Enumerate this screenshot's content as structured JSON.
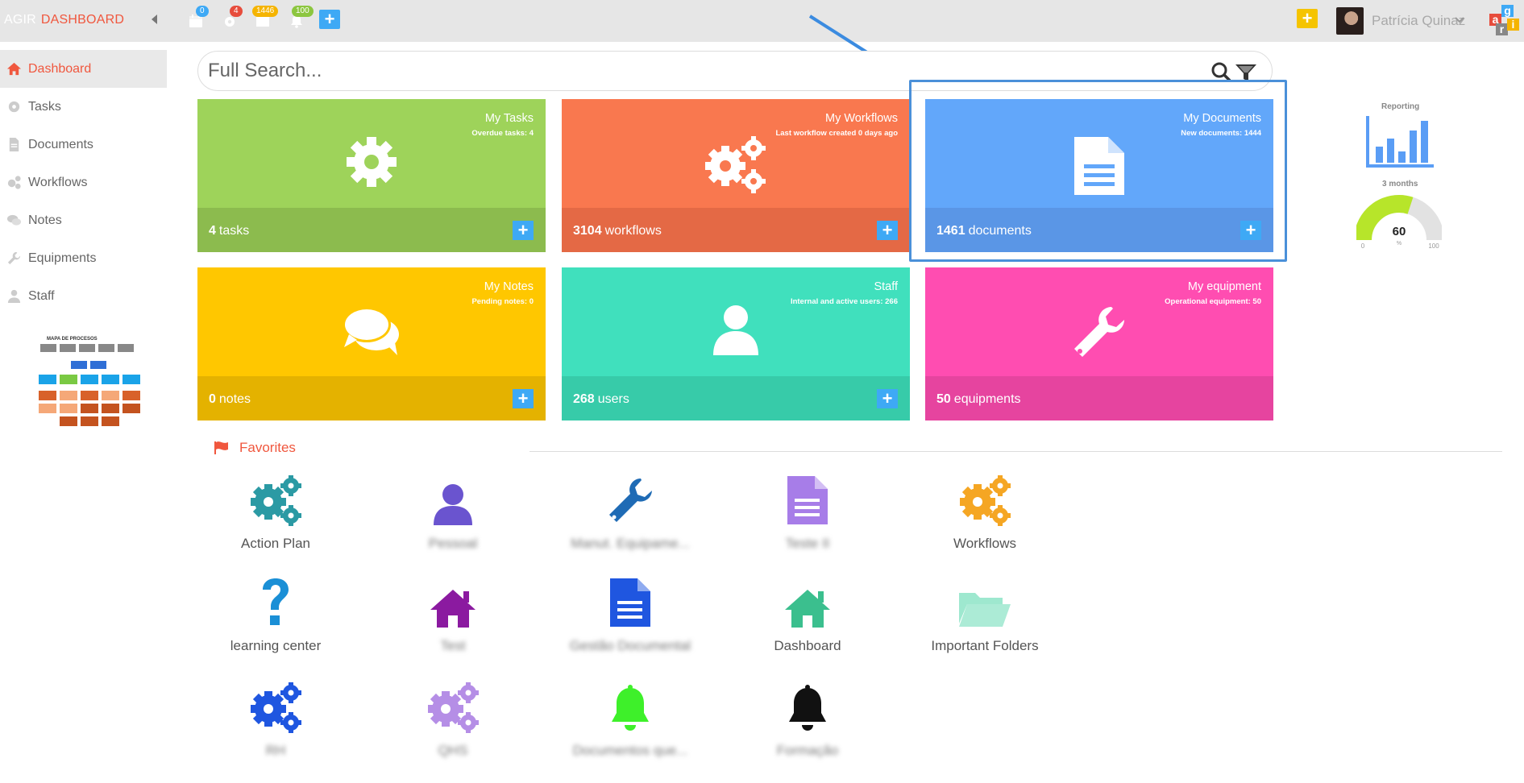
{
  "topbar": {
    "brand_primary": "AGIR",
    "brand_secondary": "DASHBOARD",
    "badges": {
      "calendar": "0",
      "settings": "4",
      "messages": "1446",
      "notifications": "100"
    },
    "user_name": "Patrícia Quinaz",
    "logo_letters": [
      "a",
      "g",
      "r",
      "i"
    ]
  },
  "sidebar": {
    "items": [
      {
        "label": "Dashboard",
        "icon": "home-icon"
      },
      {
        "label": "Tasks",
        "icon": "gear-icon"
      },
      {
        "label": "Documents",
        "icon": "document-icon"
      },
      {
        "label": "Workflows",
        "icon": "gears-icon"
      },
      {
        "label": "Notes",
        "icon": "comments-icon"
      },
      {
        "label": "Equipments",
        "icon": "wrench-icon"
      },
      {
        "label": "Staff",
        "icon": "user-icon"
      }
    ],
    "process_map_title": "MAPA DE PROCESOS"
  },
  "search": {
    "placeholder": "Full Search..."
  },
  "tiles": [
    {
      "title": "My Tasks",
      "subtitle": "Overdue tasks: 4",
      "count": "4",
      "unit": "tasks",
      "color": "#9ed35a",
      "foot_color": "#8cbb4e",
      "icon": "gear-icon"
    },
    {
      "title": "My Workflows",
      "subtitle": "Last workflow created 0 days ago",
      "count": "3104",
      "unit": "workflows",
      "color": "#f9784f",
      "foot_color": "#e46945",
      "icon": "gears-icon"
    },
    {
      "title": "My Documents",
      "subtitle": "New documents: 1444",
      "count": "1461",
      "unit": "documents",
      "color": "#62a7fa",
      "foot_color": "#5a96e6",
      "icon": "document-icon"
    },
    {
      "title": "My Notes",
      "subtitle": "Pending notes: 0",
      "count": "0",
      "unit": "notes",
      "color": "#ffc700",
      "foot_color": "#e4b200",
      "icon": "comments-icon"
    },
    {
      "title": "Staff",
      "subtitle": "Internal and active users: 266",
      "count": "268",
      "unit": "users",
      "color": "#40e0bd",
      "foot_color": "#37cba9",
      "icon": "user-icon"
    },
    {
      "title": "My equipment",
      "subtitle": "Operational equipment: 50",
      "count": "50",
      "unit": "equipments",
      "color": "#ff4db1",
      "foot_color": "#e6449f",
      "icon": "wrench-icon"
    }
  ],
  "reporting": {
    "label": "Reporting",
    "period": "3 months",
    "gauge_value": "60",
    "gauge_unit": "%",
    "gauge_min": "0",
    "gauge_max": "100",
    "gauge_fraction": 0.6
  },
  "favorites": {
    "heading": "Favorites",
    "items": [
      {
        "label": "Action Plan",
        "icon": "gears-icon",
        "color": "#2b9aa4",
        "blurred": false
      },
      {
        "label": "Pessoal",
        "icon": "user-icon",
        "color": "#6a54cf",
        "blurred": true
      },
      {
        "label": "Manut. Equipame...",
        "icon": "wrench-icon",
        "color": "#1f6bb5",
        "blurred": true
      },
      {
        "label": "Teste II",
        "icon": "document-icon",
        "color": "#a77de8",
        "blurred": true
      },
      {
        "label": "Workflows",
        "icon": "gears-icon",
        "color": "#f5a623",
        "blurred": false
      },
      {
        "label": "learning center",
        "icon": "question-icon",
        "color": "#1a8fd6",
        "blurred": false
      },
      {
        "label": "Test",
        "icon": "home-icon",
        "color": "#8b1aa0",
        "blurred": true
      },
      {
        "label": "Gestão Documental",
        "icon": "document-icon",
        "color": "#1f56e0",
        "blurred": true
      },
      {
        "label": "Dashboard",
        "icon": "home-icon",
        "color": "#3bbf8e",
        "blurred": false
      },
      {
        "label": "Important Folders",
        "icon": "folder-icon",
        "color": "#9ee8cf",
        "blurred": false
      },
      {
        "label": "RH",
        "icon": "gears-icon",
        "color": "#1f56e0",
        "blurred": true
      },
      {
        "label": "QHS",
        "icon": "gears-icon",
        "color": "#b58ee6",
        "blurred": true
      },
      {
        "label": "Documentos que...",
        "icon": "bell-icon",
        "color": "#3ef02a",
        "blurred": true
      },
      {
        "label": "Formação",
        "icon": "bell-icon",
        "color": "#111111",
        "blurred": true
      }
    ]
  }
}
